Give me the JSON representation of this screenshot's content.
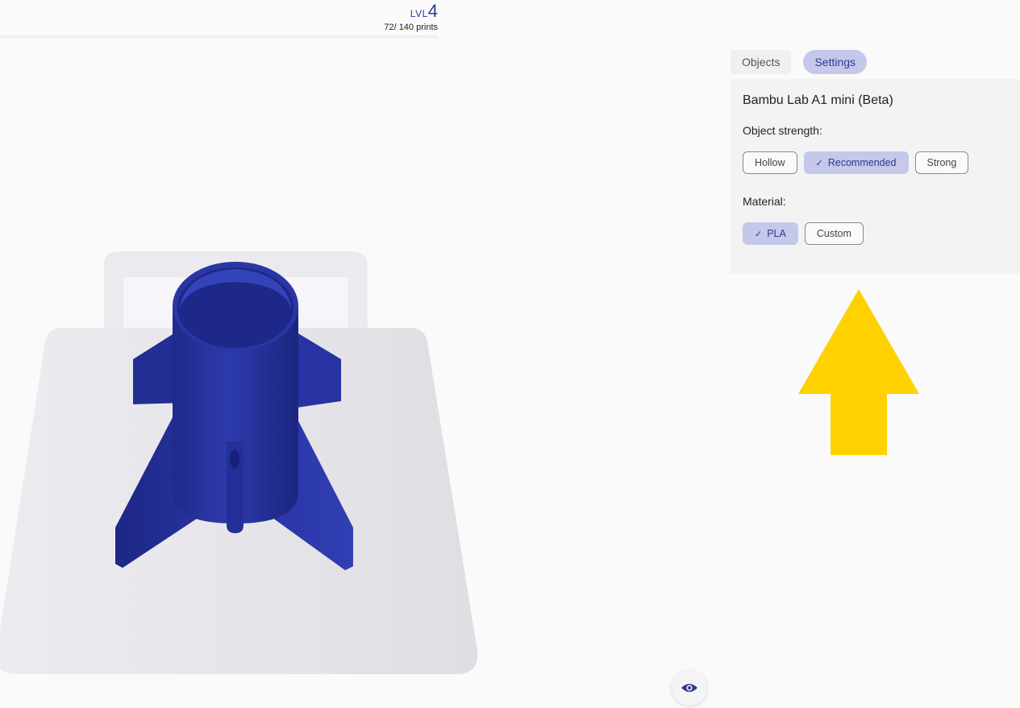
{
  "header": {
    "level_prefix": "LVL",
    "level_number": "4",
    "prints": "72/ 140 prints"
  },
  "tabs": [
    {
      "label": "Objects",
      "active": false
    },
    {
      "label": "Settings",
      "active": true
    }
  ],
  "settings": {
    "printer_name": "Bambu Lab A1 mini (Beta)",
    "strength_label": "Object strength:",
    "strength_options": [
      {
        "label": "Hollow",
        "selected": false
      },
      {
        "label": "Recommended",
        "selected": true
      },
      {
        "label": "Strong",
        "selected": false
      }
    ],
    "material_label": "Material:",
    "material_options": [
      {
        "label": "PLA",
        "selected": true
      },
      {
        "label": "Custom",
        "selected": false
      }
    ],
    "check_glyph": "✓"
  },
  "viewport": {
    "model_color": "#2a35a0",
    "view_toggle_icon": "eye-icon"
  },
  "colors": {
    "accent": "#2b3990",
    "accent_soft": "#c5c8ea",
    "arrow": "#ffd100"
  }
}
